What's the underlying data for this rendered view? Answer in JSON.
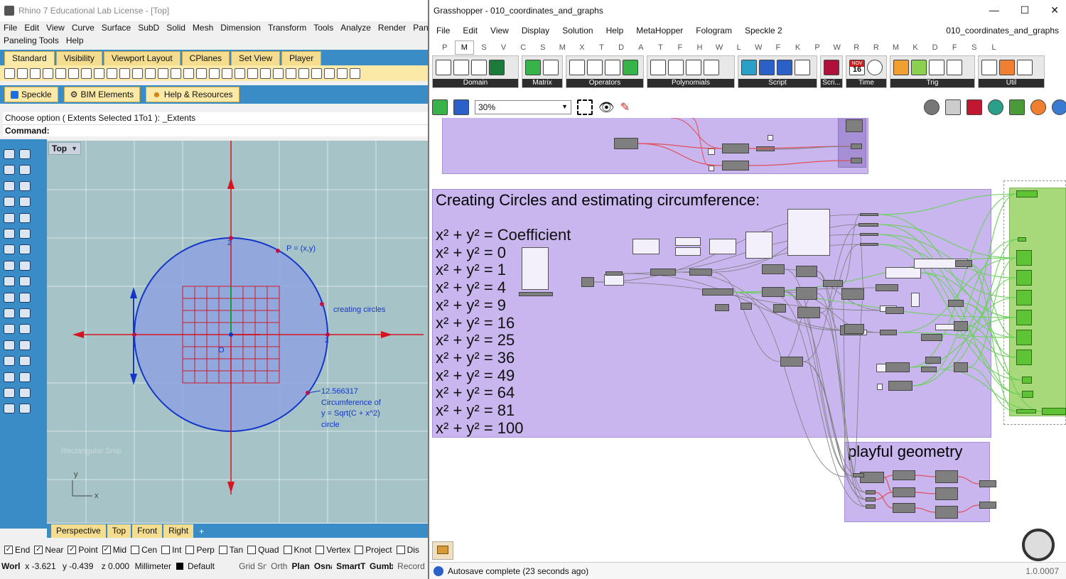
{
  "rhino": {
    "title": "Rhino 7 Educational Lab License - [Top]",
    "menu": [
      "File",
      "Edit",
      "View",
      "Curve",
      "Surface",
      "SubD",
      "Solid",
      "Mesh",
      "Dimension",
      "Transform",
      "Tools",
      "Analyze",
      "Render",
      "Pane"
    ],
    "menu2": [
      "Paneling Tools",
      "Help"
    ],
    "toolbar_tabs": [
      "Standard",
      "Visibility",
      "Viewport Layout",
      "CPlanes",
      "Set View",
      "Player"
    ],
    "plugin_tabs": [
      "Speckle",
      "BIM Elements",
      "Help & Resources"
    ],
    "command_history": "Choose option ( Extents  Selected  1To1 ): _Extents",
    "command_prompt": "Command:",
    "viewport_label": "Top",
    "annotations": {
      "point_label": "P = (x,y)",
      "creating_circles": "creating circles",
      "circ_value": "12.566317",
      "circ_line1": "Circumference of",
      "circ_line2": "y = Sqrt(C + x^2)",
      "circ_line3": "circle",
      "axis_2_top": "2",
      "axis_2_right": "2",
      "origin": "O",
      "y_axis": "y",
      "x_axis": "x",
      "ghost_text": "Rectangular Snip"
    },
    "viewport_tabs": [
      "Perspective",
      "Top",
      "Front",
      "Right"
    ],
    "add_tab": "+",
    "osnaps": [
      {
        "label": "End",
        "checked": true
      },
      {
        "label": "Near",
        "checked": true
      },
      {
        "label": "Point",
        "checked": true
      },
      {
        "label": "Mid",
        "checked": true
      },
      {
        "label": "Cen",
        "checked": false
      },
      {
        "label": "Int",
        "checked": false
      },
      {
        "label": "Perp",
        "checked": false
      },
      {
        "label": "Tan",
        "checked": false
      },
      {
        "label": "Quad",
        "checked": false
      },
      {
        "label": "Knot",
        "checked": false
      },
      {
        "label": "Vertex",
        "checked": false
      },
      {
        "label": "Project",
        "checked": false
      },
      {
        "label": "Dis",
        "checked": false
      }
    ],
    "status": {
      "cplane": "World",
      "x": "x -3.621",
      "y": "y -0.439",
      "z": "z 0.000",
      "units": "Millimeter",
      "layer": "Default",
      "grid": "Grid Snap",
      "ortho": "Ortho",
      "planar": "Planar",
      "osnap": "Osnap",
      "smarttrack": "SmartTrack",
      "gumball": "Gumball",
      "record": "Record H"
    }
  },
  "gh": {
    "title": "Grasshopper - 010_coordinates_and_graphs",
    "window_buttons": [
      "—",
      "☐",
      "✕"
    ],
    "menu": [
      "File",
      "Edit",
      "View",
      "Display",
      "Solution",
      "Help",
      "MetaHopper",
      "Fologram",
      "Speckle 2"
    ],
    "filename": "010_coordinates_and_graphs",
    "tab_letters": [
      "P",
      "M",
      "S",
      "V",
      "C",
      "S",
      "M",
      "X",
      "T",
      "D",
      "A",
      "T",
      "F",
      "H",
      "W",
      "L",
      "W",
      "F",
      "K",
      "P",
      "W",
      "R",
      "R",
      "M",
      "K",
      "D",
      "F",
      "S",
      "L"
    ],
    "selected_letter_index": 1,
    "ribbon_groups": [
      "Domain",
      "Matrix",
      "Operators",
      "Polynomials",
      "Script",
      "Scri...",
      "Time",
      "Trig",
      "Util"
    ],
    "zoom": "30%",
    "calendar_month": "NOV",
    "calendar_day": "16",
    "group_circles_title": "Creating Circles and estimating circumference:",
    "equations": [
      "x² + y² = Coefficient",
      "x² + y² = 0",
      "x² + y² = 1",
      "x² + y² = 4",
      "x² + y² = 9",
      "x² + y² = 16",
      "x² + y² = 25",
      "x² + y² = 36",
      "x² + y² = 49",
      "x² + y² = 64",
      "x² + y² = 81",
      "x² + y² = 100"
    ],
    "group_playful_title": "playful geometry",
    "status_text": "Autosave complete (23 seconds ago)",
    "version": "1.0.0007",
    "colors": {
      "group_purple": "#c9b6ef",
      "panel_green": "#a7d97a",
      "wire_green": "#6bd05a",
      "wire_red": "#e0505a",
      "rhino_blue": "#3a8cc6",
      "circle_fill": "#8ea3df"
    }
  }
}
